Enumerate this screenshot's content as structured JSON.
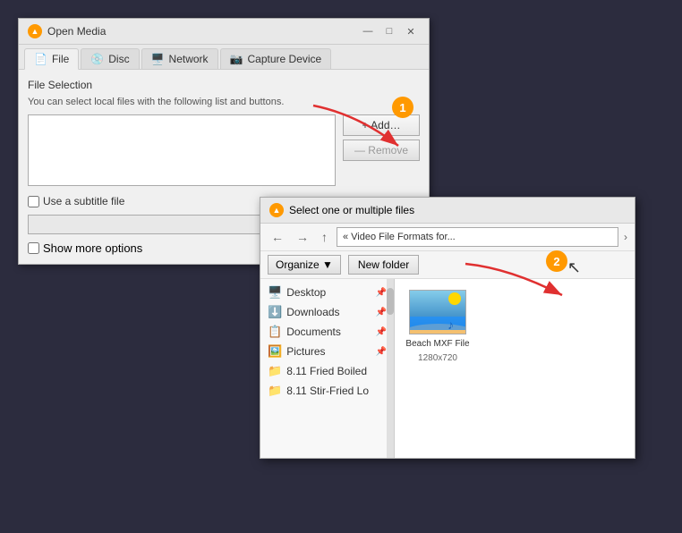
{
  "mainDialog": {
    "title": "Open Media",
    "tabs": [
      {
        "label": "File",
        "icon": "📄",
        "active": true
      },
      {
        "label": "Disc",
        "icon": "💿",
        "active": false
      },
      {
        "label": "Network",
        "icon": "🖥️",
        "active": false
      },
      {
        "label": "Capture Device",
        "icon": "📷",
        "active": false
      }
    ],
    "fileSection": {
      "label": "File Selection",
      "description": "You can select local files with the following list and buttons.",
      "addButton": "+ Add…",
      "removeButton": "— Remove"
    },
    "subtitleLabel": "Use a subtitle file",
    "showMoreLabel": "Show more options",
    "windowControls": {
      "minimize": "—",
      "maximize": "□",
      "close": "✕"
    }
  },
  "fileDialog": {
    "title": "Select one or multiple files",
    "pathDisplay": "« Video File Formats for...",
    "organizeLabel": "Organize ▼",
    "newFolderLabel": "New folder",
    "treeItems": [
      {
        "label": "Desktop",
        "icon": "🖥️",
        "pinned": true
      },
      {
        "label": "Downloads",
        "icon": "⬇️",
        "pinned": true
      },
      {
        "label": "Documents",
        "icon": "📋",
        "pinned": true
      },
      {
        "label": "Pictures",
        "icon": "🖼️",
        "pinned": true
      },
      {
        "label": "8.11 Fried Boiled",
        "icon": "📁",
        "pinned": false
      },
      {
        "label": "8.11 Stir-Fried Lo",
        "icon": "📁",
        "pinned": false
      }
    ],
    "fileItem": {
      "name": "Beach MXF File",
      "resolution": "1280x720"
    }
  },
  "annotations": {
    "badge1": "1",
    "badge2": "2"
  }
}
